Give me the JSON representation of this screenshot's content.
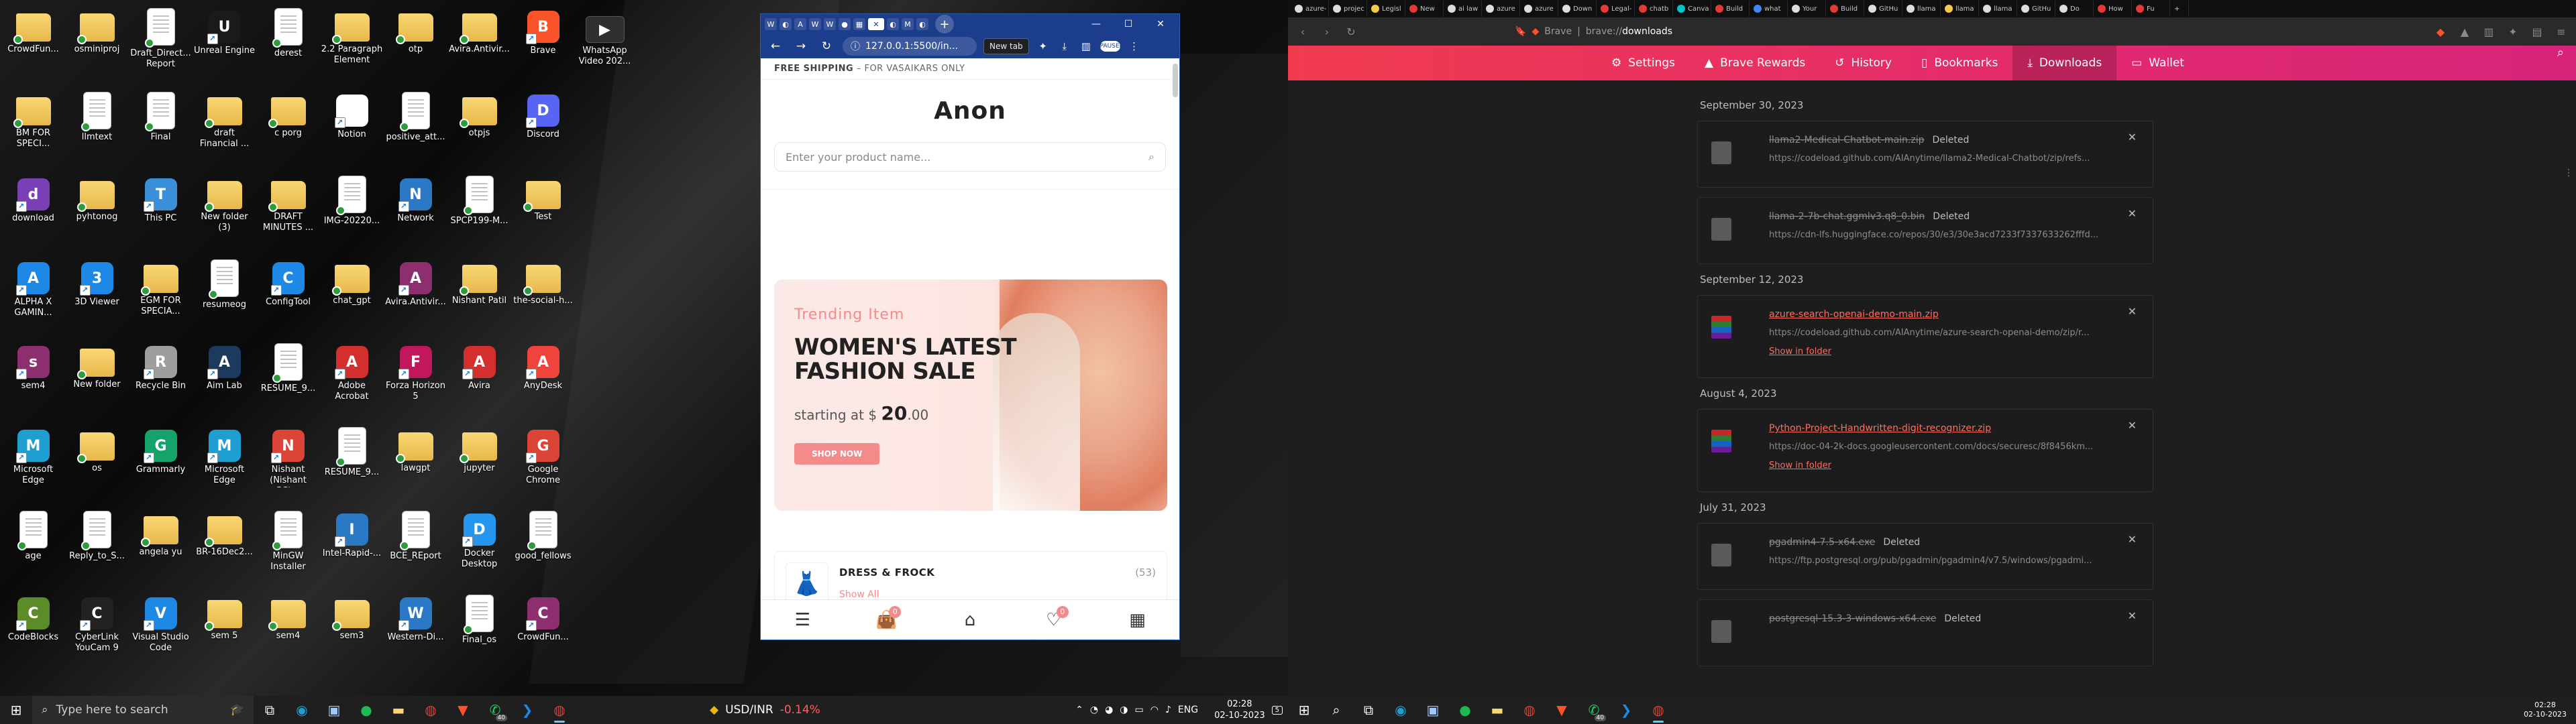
{
  "desktop": {
    "icons": [
      {
        "label": "CrowdFun...",
        "icon": "folder-icon",
        "kind": "folder",
        "color": "#e9b94a"
      },
      {
        "label": "BM FOR SPECI...",
        "icon": "folder-icon",
        "kind": "folder",
        "color": "#e9b94a"
      },
      {
        "label": "download",
        "icon": "onenote-icon",
        "kind": "app",
        "color": "#7b3fb7"
      },
      {
        "label": "ALPHA X GAMIN...",
        "icon": "vscode-alt-icon",
        "kind": "app",
        "color": "#1e88e5"
      },
      {
        "label": "sem4",
        "icon": "archive-icon",
        "kind": "app",
        "color": "#8d2f6e"
      },
      {
        "label": "Microsoft Edge",
        "icon": "edge-icon",
        "kind": "app",
        "color": "#1f9fd1"
      },
      {
        "label": "age",
        "icon": "document-icon",
        "kind": "doc",
        "color": "#ffffff"
      },
      {
        "label": "CodeBlocks",
        "icon": "codeblocks-icon",
        "kind": "app",
        "color": "#5c8b2a"
      },
      {
        "label": "osminiproj",
        "icon": "folder-icon",
        "kind": "folder",
        "color": "#e9b94a"
      },
      {
        "label": "llmtext",
        "icon": "document-icon",
        "kind": "doc",
        "color": "#ffffff"
      },
      {
        "label": "pyhtonog",
        "icon": "folder-icon",
        "kind": "folder",
        "color": "#e9b94a"
      },
      {
        "label": "3D Viewer",
        "icon": "3d-viewer-icon",
        "kind": "app",
        "color": "#1e88e5"
      },
      {
        "label": "New folder",
        "icon": "folder-icon",
        "kind": "folder",
        "color": "#e9b94a"
      },
      {
        "label": "os",
        "icon": "folder-icon",
        "kind": "folder",
        "color": "#e9b94a"
      },
      {
        "label": "Reply_to_S...",
        "icon": "document-icon",
        "kind": "doc",
        "color": "#ffffff"
      },
      {
        "label": "CyberLink YouCam 9",
        "icon": "youcam-icon",
        "kind": "app",
        "color": "#222222"
      },
      {
        "label": "Draft_Direct... Report",
        "icon": "document-icon",
        "kind": "doc",
        "color": "#ffffff"
      },
      {
        "label": "Final",
        "icon": "document-icon",
        "kind": "doc",
        "color": "#ffffff"
      },
      {
        "label": "This PC",
        "icon": "this-pc-icon",
        "kind": "app",
        "color": "#3b8fd8"
      },
      {
        "label": "EGM FOR SPECIA...",
        "icon": "folder-icon",
        "kind": "folder",
        "color": "#e9b94a"
      },
      {
        "label": "Recycle Bin",
        "icon": "recycle-bin-icon",
        "kind": "app",
        "color": "#9e9e9e"
      },
      {
        "label": "Grammarly",
        "icon": "grammarly-icon",
        "kind": "app",
        "color": "#15a36b"
      },
      {
        "label": "angela yu",
        "icon": "folder-icon",
        "kind": "folder",
        "color": "#e9b94a"
      },
      {
        "label": "Visual Studio Code",
        "icon": "vscode-icon",
        "kind": "app",
        "color": "#1e88e5"
      },
      {
        "label": "Unreal Engine",
        "icon": "unreal-icon",
        "kind": "app",
        "color": "#1a1a1a"
      },
      {
        "label": "draft Financial ...",
        "icon": "folder-icon",
        "kind": "folder",
        "color": "#e9b94a"
      },
      {
        "label": "New folder (3)",
        "icon": "folder-icon",
        "kind": "folder",
        "color": "#e9b94a"
      },
      {
        "label": "resumeog",
        "icon": "document-icon",
        "kind": "doc",
        "color": "#ffffff"
      },
      {
        "label": "Aim Lab",
        "icon": "aimlab-icon",
        "kind": "app",
        "color": "#1c3a5e"
      },
      {
        "label": "Microsoft Edge",
        "icon": "edge-icon",
        "kind": "app",
        "color": "#1f9fd1"
      },
      {
        "label": "BR-16Dec2...",
        "icon": "folder-icon",
        "kind": "folder",
        "color": "#e9b94a"
      },
      {
        "label": "sem 5",
        "icon": "folder-icon",
        "kind": "folder",
        "color": "#e9b94a"
      },
      {
        "label": "derest",
        "icon": "document-icon",
        "kind": "doc",
        "color": "#ffffff"
      },
      {
        "label": "c porg",
        "icon": "folder-icon",
        "kind": "folder",
        "color": "#e9b94a"
      },
      {
        "label": "DRAFT MINUTES ...",
        "icon": "folder-icon",
        "kind": "folder",
        "color": "#e9b94a"
      },
      {
        "label": "ConfigTool",
        "icon": "config-tool-icon",
        "kind": "app",
        "color": "#1e88e5"
      },
      {
        "label": "RESUME_9...",
        "icon": "document-icon",
        "kind": "doc",
        "color": "#ffffff"
      },
      {
        "label": "Nishant (Nishant PC)...",
        "icon": "chrome-icon",
        "kind": "app",
        "color": "#db4437"
      },
      {
        "label": "MinGW Installer",
        "icon": "document-icon",
        "kind": "doc",
        "color": "#ffffff"
      },
      {
        "label": "sem4",
        "icon": "folder-icon",
        "kind": "folder",
        "color": "#e9b94a"
      },
      {
        "label": "2.2 Paragraph Element",
        "icon": "folder-icon",
        "kind": "folder",
        "color": "#e9b94a"
      },
      {
        "label": "Notion",
        "icon": "notion-icon",
        "kind": "app",
        "color": "#ffffff"
      },
      {
        "label": "IMG-20220...",
        "icon": "image-icon",
        "kind": "doc",
        "color": "#ffffff"
      },
      {
        "label": "chat_gpt",
        "icon": "folder-icon",
        "kind": "folder",
        "color": "#e9b94a"
      },
      {
        "label": "Adobe Acrobat",
        "icon": "acrobat-icon",
        "kind": "app",
        "color": "#d32f2f"
      },
      {
        "label": "RESUME_9...",
        "icon": "document-icon",
        "kind": "doc",
        "color": "#ffffff"
      },
      {
        "label": "Intel-Rapid-...",
        "icon": "intel-icon",
        "kind": "app",
        "color": "#2b78c5"
      },
      {
        "label": "sem3",
        "icon": "folder-icon",
        "kind": "folder",
        "color": "#e9b94a"
      },
      {
        "label": "otp",
        "icon": "folder-icon",
        "kind": "folder",
        "color": "#e9b94a"
      },
      {
        "label": "positive_att...",
        "icon": "document-icon",
        "kind": "doc",
        "color": "#ffffff"
      },
      {
        "label": "Network",
        "icon": "network-icon",
        "kind": "app",
        "color": "#2b78c5"
      },
      {
        "label": "Avira.Antivir...",
        "icon": "archive-icon",
        "kind": "app",
        "color": "#8d2f6e"
      },
      {
        "label": "Forza Horizon 5",
        "icon": "forza-icon",
        "kind": "app",
        "color": "#c2185b"
      },
      {
        "label": "lawgpt",
        "icon": "folder-icon",
        "kind": "folder",
        "color": "#e9b94a"
      },
      {
        "label": "BCE_REport",
        "icon": "document-icon",
        "kind": "doc",
        "color": "#ffffff"
      },
      {
        "label": "Western-Di...",
        "icon": "intel-icon",
        "kind": "app",
        "color": "#2b78c5"
      },
      {
        "label": "Avira.Antivir...",
        "icon": "folder-icon",
        "kind": "folder",
        "color": "#e9b94a"
      },
      {
        "label": "otpjs",
        "icon": "folder-icon",
        "kind": "folder",
        "color": "#e9b94a"
      },
      {
        "label": "SPCP199-M...",
        "icon": "document-icon",
        "kind": "doc",
        "color": "#ffffff"
      },
      {
        "label": "Nishant Patil",
        "icon": "user-folder-icon",
        "kind": "folder",
        "color": "#e9b94a"
      },
      {
        "label": "Avira",
        "icon": "avira-icon",
        "kind": "app",
        "color": "#d32f2f"
      },
      {
        "label": "jupyter",
        "icon": "folder-icon",
        "kind": "folder",
        "color": "#e9b94a"
      },
      {
        "label": "Docker Desktop",
        "icon": "docker-icon",
        "kind": "app",
        "color": "#2496ed"
      },
      {
        "label": "Final_os",
        "icon": "document-icon",
        "kind": "doc",
        "color": "#ffffff"
      },
      {
        "label": "Brave",
        "icon": "brave-icon",
        "kind": "app",
        "color": "#fb542b"
      },
      {
        "label": "Discord",
        "icon": "discord-icon",
        "kind": "app",
        "color": "#5865f2"
      },
      {
        "label": "Test",
        "icon": "folder-icon",
        "kind": "folder",
        "color": "#e9b94a"
      },
      {
        "label": "the-social-h...",
        "icon": "folder-icon",
        "kind": "folder",
        "color": "#e9b94a"
      },
      {
        "label": "AnyDesk",
        "icon": "anydesk-icon",
        "kind": "app",
        "color": "#ef443b"
      },
      {
        "label": "Google Chrome",
        "icon": "chrome-icon",
        "kind": "app",
        "color": "#db4437"
      },
      {
        "label": "good_fellows",
        "icon": "document-icon",
        "kind": "doc",
        "color": "#ffffff"
      },
      {
        "label": "CrowdFun...",
        "icon": "archive-icon",
        "kind": "app",
        "color": "#8d2f6e"
      }
    ],
    "extra_icon": {
      "label": "WhatsApp Video 202...",
      "icon": "video-icon"
    }
  },
  "popup_browser": {
    "tooltip": "New tab",
    "url": "127.0.0.1:5500/in...",
    "profile_label": "PAUSED",
    "page": {
      "shipping_prefix": "FREE SHIPPING",
      "shipping_text": "– FOR VASAIKARS ONLY",
      "logo": "Anon",
      "search_placeholder": "Enter your product name...",
      "hero": {
        "tag": "Trending Item",
        "title": "WOMEN'S LATEST FASHION SALE",
        "price_prefix": "starting at $ ",
        "price_whole": "20",
        "price_cents": ".00",
        "button": "SHOP NOW"
      },
      "category": {
        "name": "DRESS & FROCK",
        "count": "(53)",
        "link": "Show All"
      },
      "nav_badges": {
        "cart": "0",
        "wishlist": "0"
      }
    }
  },
  "taskbar_left": {
    "search_placeholder": "Type here to search",
    "ticker_symbol": "USD/INR",
    "ticker_change": "-0.14%",
    "lang": "ENG",
    "time": "02:28",
    "date": "02-10-2023",
    "notif_count": "5",
    "app_badge": "40"
  },
  "brave": {
    "tabs": [
      {
        "label": "azure-",
        "color": "#dddddd"
      },
      {
        "label": "projec",
        "color": "#dddddd"
      },
      {
        "label": "Legisl",
        "color": "#f7c948"
      },
      {
        "label": "New",
        "color": "#e53935"
      },
      {
        "label": "ai law",
        "color": "#dddddd"
      },
      {
        "label": "azure",
        "color": "#dddddd"
      },
      {
        "label": "azure",
        "color": "#dddddd"
      },
      {
        "label": "Down",
        "color": "#dddddd"
      },
      {
        "label": "Legal-",
        "color": "#e53935"
      },
      {
        "label": "chatb",
        "color": "#e53935"
      },
      {
        "label": "Canva",
        "color": "#00c4cc"
      },
      {
        "label": "Build",
        "color": "#e53935"
      },
      {
        "label": "what",
        "color": "#4285f4"
      },
      {
        "label": "Your",
        "color": "#dddddd"
      },
      {
        "label": "Build",
        "color": "#e53935"
      },
      {
        "label": "GitHu",
        "color": "#dddddd"
      },
      {
        "label": "llama",
        "color": "#dddddd"
      },
      {
        "label": "llama",
        "color": "#f7c948"
      },
      {
        "label": "llama",
        "color": "#dddddd"
      },
      {
        "label": "GitHu",
        "color": "#dddddd"
      },
      {
        "label": "Do",
        "color": "#dddddd"
      },
      {
        "label": "How",
        "color": "#e53935"
      },
      {
        "label": "Fu",
        "color": "#e53935"
      }
    ],
    "address_brand": "Brave",
    "address_host": "brave://",
    "address_path": "downloads",
    "nav": [
      {
        "label": "Settings",
        "icon": "gear-icon"
      },
      {
        "label": "Brave Rewards",
        "icon": "rewards-icon"
      },
      {
        "label": "History",
        "icon": "history-icon"
      },
      {
        "label": "Bookmarks",
        "icon": "bookmark-icon"
      },
      {
        "label": "Downloads",
        "icon": "download-icon"
      },
      {
        "label": "Wallet",
        "icon": "wallet-icon"
      }
    ],
    "downloads": [
      {
        "date": "September 30, 2023",
        "items": [
          {
            "name": "llama2-Medical-Chatbot-main.zip",
            "status": "Deleted",
            "url": "https://codeload.github.com/AIAnytime/llama2-Medical-Chatbot/zip/refs...",
            "icon": "zip",
            "deleted": true,
            "action": ""
          },
          {
            "name": "llama-2-7b-chat.ggmlv3.q8_0.bin",
            "status": "Deleted",
            "url": "https://cdn-lfs.huggingface.co/repos/30/e3/30e3acd7233f7337633262fffd...",
            "icon": "file",
            "deleted": true,
            "action": ""
          }
        ]
      },
      {
        "date": "September 12, 2023",
        "items": [
          {
            "name": "azure-search-openai-demo-main.zip",
            "status": "",
            "url": "https://codeload.github.com/AIAnytime/azure-search-openai-demo/zip/r...",
            "icon": "archive",
            "deleted": false,
            "action": "Show in folder"
          }
        ]
      },
      {
        "date": "August 4, 2023",
        "items": [
          {
            "name": "Python-Project-Handwritten-digit-recognizer.zip",
            "status": "",
            "url": "https://doc-04-2k-docs.googleusercontent.com/docs/securesc/8f8456km...",
            "icon": "archive",
            "deleted": false,
            "action": "Show in folder"
          }
        ]
      },
      {
        "date": "July 31, 2023",
        "items": [
          {
            "name": "pgadmin4-7.5-x64.exe",
            "status": "Deleted",
            "url": "https://ftp.postgresql.org/pub/pgadmin/pgadmin4/v7.5/windows/pgadmi...",
            "icon": "exe",
            "deleted": true,
            "action": ""
          },
          {
            "name": "postgresql-15.3-3-windows-x64.exe",
            "status": "Deleted",
            "url": "",
            "icon": "exe",
            "deleted": true,
            "action": ""
          }
        ]
      }
    ]
  },
  "taskbar_right": {
    "time": "02:28",
    "date": "02-10-2023",
    "app_badge": "40"
  }
}
